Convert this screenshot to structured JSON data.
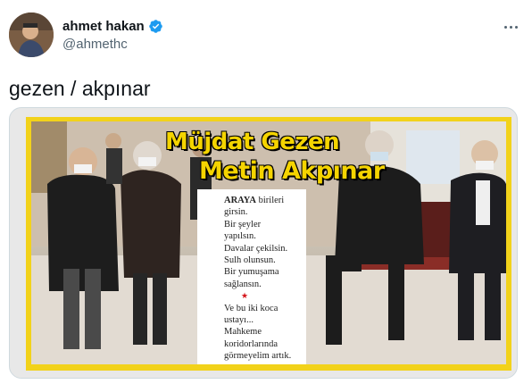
{
  "author": {
    "name": "ahmet hakan",
    "handle": "@ahmethc",
    "verified": true
  },
  "tweet": {
    "text": "gezen / akpınar"
  },
  "media": {
    "headline_line1": "Müjdat Gezen",
    "headline_line2": "Metin Akpınar",
    "column": {
      "lead_bold": "ARAYA",
      "lines": [
        "birileri",
        "girsin.",
        "Bir şeyler",
        "yapılsın.",
        "Davalar çekilsin.",
        "Sulh olunsun.",
        "Bir yumuşama",
        "sağlansın.",
        "Ve bu iki koca",
        "ustayı...",
        "Mahkeme",
        "koridorlarında",
        "görmeyelim artık."
      ],
      "star": "★"
    }
  },
  "colors": {
    "verified": "#1d9bf0",
    "frame": "#f2d21a",
    "headline": "#f5d400"
  },
  "icons": [
    "verified-badge-icon",
    "more-icon"
  ]
}
